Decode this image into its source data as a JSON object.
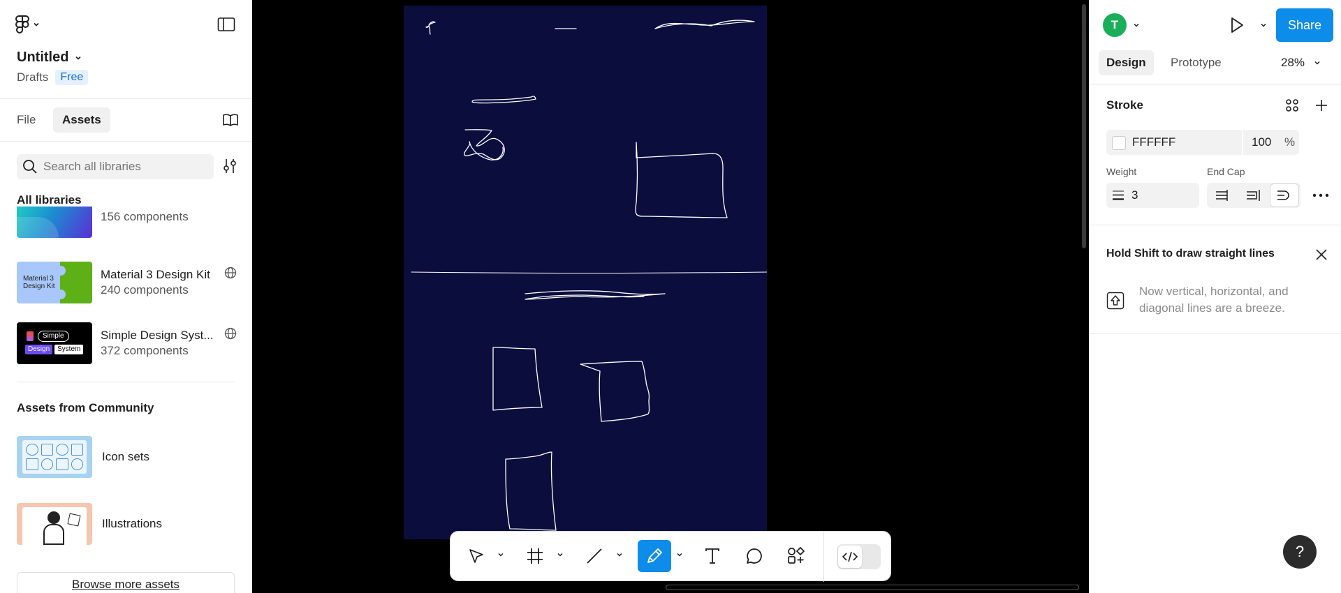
{
  "file": {
    "title": "Untitled",
    "location": "Drafts",
    "plan_badge": "Free"
  },
  "left_panel": {
    "tabs": {
      "file": "File",
      "assets": "Assets"
    },
    "search": {
      "placeholder": "Search all libraries"
    },
    "all_libraries_heading": "All libraries",
    "libraries": [
      {
        "name": "",
        "count": "156 components"
      },
      {
        "name": "Material 3 Design Kit",
        "count": "240 components",
        "thumb_text_1": "Material 3",
        "thumb_text_2": "Design Kit"
      },
      {
        "name": "Simple Design Syst...",
        "count": "372 components",
        "thumb_text_1": "Simple",
        "thumb_text_2": "Design",
        "thumb_text_3": "System"
      }
    ],
    "community_heading": "Assets from Community",
    "community": [
      {
        "name": "Icon sets"
      },
      {
        "name": "Illustrations"
      }
    ],
    "browse_button": "Browse more assets"
  },
  "right_panel": {
    "avatar_initial": "T",
    "share_label": "Share",
    "tabs": {
      "design": "Design",
      "prototype": "Prototype"
    },
    "zoom": "28%",
    "stroke": {
      "heading": "Stroke",
      "color_hex": "FFFFFF",
      "color": "#FFFFFF",
      "opacity": "100",
      "opacity_unit": "%",
      "weight_label": "Weight",
      "weight_value": "3",
      "end_cap_label": "End Cap"
    },
    "tip": {
      "title": "Hold Shift to draw straight lines",
      "body": "Now vertical, horizontal, and diagonal lines are a breeze."
    }
  },
  "toolbar": {
    "tools": [
      "move",
      "frame",
      "line",
      "pencil",
      "text",
      "comment",
      "actions"
    ],
    "active_tool": "pencil"
  },
  "colors": {
    "accent": "#0D8CE9",
    "frame_fill": "#0B0D3D",
    "avatar": "#1BAE5A",
    "free_badge": "#E5F0FD"
  }
}
